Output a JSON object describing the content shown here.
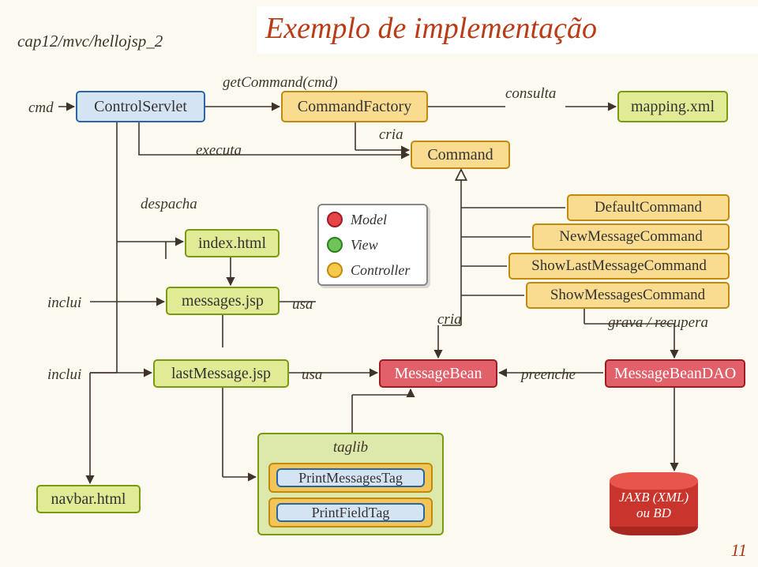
{
  "header": {
    "subtitle": "cap12/mvc/hellojsp_2",
    "title": "Exemplo de implementação"
  },
  "labels": {
    "cmd": "cmd",
    "getCommand": "getCommand(cmd)",
    "consulta": "consulta",
    "executa": "executa",
    "cria1": "cria",
    "despacha": "despacha",
    "inclui1": "inclui",
    "usa1": "usa",
    "cria2": "cria",
    "grava": "grava / recupera",
    "inclui2": "inclui",
    "usa2": "usa",
    "preenche": "preenche",
    "taglib": "taglib"
  },
  "boxes": {
    "controlServlet": "ControlServlet",
    "commandFactory": "CommandFactory",
    "mapping": "mapping.xml",
    "command": "Command",
    "indexHtml": "index.html",
    "messagesJsp": "messages.jsp",
    "lastMessageJsp": "lastMessage.jsp",
    "messageBean": "MessageBean",
    "messageBeanDAO": "MessageBeanDAO",
    "defaultCommand": "DefaultCommand",
    "newMessageCommand": "NewMessageCommand",
    "showLastMessageCommand": "ShowLastMessageCommand",
    "showMessagesCommand": "ShowMessagesCommand",
    "navbar": "navbar.html",
    "printMessagesTag": "PrintMessagesTag",
    "printFieldTag": "PrintFieldTag"
  },
  "mvc": {
    "model": "Model",
    "view": "View",
    "controller": "Controller"
  },
  "colors": {
    "model": "#e64545",
    "view": "#6fc45a",
    "controller": "#f6c84c"
  },
  "db": {
    "line1": "JAXB (XML)",
    "line2": "ou BD"
  },
  "page": "11"
}
